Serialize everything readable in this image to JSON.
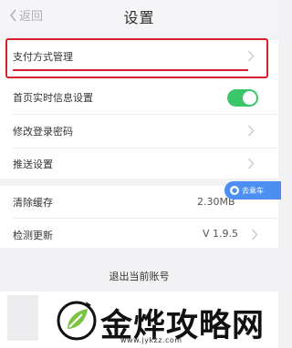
{
  "nav": {
    "back_label": "返回",
    "title": "设置"
  },
  "settings": {
    "payment": "支付方式管理",
    "realtime": "首页实时信息设置",
    "realtime_on": true,
    "password": "修改登录密码",
    "push": "推送设置",
    "cache": "清除缓存",
    "cache_size": "2.30MB",
    "update": "检测更新",
    "version": "V 1.9.5"
  },
  "badge": {
    "text": "去乘车"
  },
  "logout": "退出当前账号",
  "watermark": {
    "text": "金烨攻略网",
    "url": "www.jykzz.com"
  },
  "colors": {
    "highlight": "#d6202a",
    "toggle": "#3cc66a",
    "badge": "#4d8ef2"
  }
}
